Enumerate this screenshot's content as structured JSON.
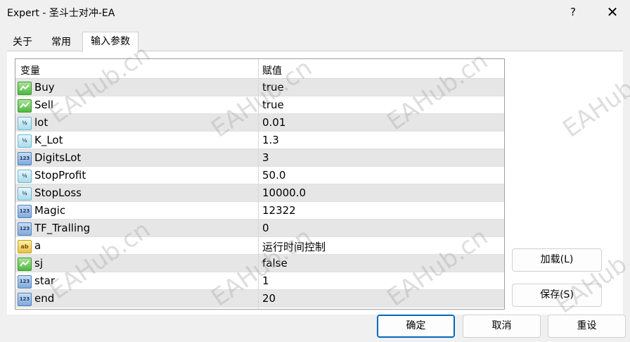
{
  "window": {
    "title": "Expert - 圣斗士对冲-EA",
    "help_label": "?",
    "close_label": "✕"
  },
  "tabs": [
    {
      "label": "关于"
    },
    {
      "label": "常用"
    },
    {
      "label": "输入参数",
      "active": true
    }
  ],
  "grid": {
    "headers": {
      "variable": "变量",
      "value": "赋值"
    },
    "rows": [
      {
        "name": "Buy",
        "value": "true",
        "type": "bool",
        "icon": "bool-icon"
      },
      {
        "name": "Sell",
        "value": "true",
        "type": "bool",
        "icon": "bool-icon"
      },
      {
        "name": "lot",
        "value": "0.01",
        "type": "double",
        "icon": "double-icon",
        "glyph": "½"
      },
      {
        "name": "K_Lot",
        "value": "1.3",
        "type": "double",
        "icon": "double-icon",
        "glyph": "½"
      },
      {
        "name": "DigitsLot",
        "value": "3",
        "type": "int",
        "icon": "int-icon",
        "glyph": "123"
      },
      {
        "name": "StopProfit",
        "value": "50.0",
        "type": "double",
        "icon": "double-icon",
        "glyph": "½"
      },
      {
        "name": "StopLoss",
        "value": "10000.0",
        "type": "double",
        "icon": "double-icon",
        "glyph": "½"
      },
      {
        "name": "Magic",
        "value": "12322",
        "type": "int",
        "icon": "int-icon",
        "glyph": "123"
      },
      {
        "name": "TF_Tralling",
        "value": "0",
        "type": "int",
        "icon": "int-icon",
        "glyph": "123"
      },
      {
        "name": "a",
        "value": "运行时间控制",
        "type": "string",
        "icon": "string-icon",
        "glyph": "ab"
      },
      {
        "name": "sj",
        "value": "false",
        "type": "bool",
        "icon": "bool-icon"
      },
      {
        "name": "star",
        "value": "1",
        "type": "int",
        "icon": "int-icon",
        "glyph": "123"
      },
      {
        "name": "end",
        "value": "20",
        "type": "int",
        "icon": "int-icon",
        "glyph": "123"
      }
    ]
  },
  "buttons": {
    "load": "加载(L)",
    "save": "保存(S)",
    "ok": "确定",
    "cancel": "取消",
    "reset": "重设"
  },
  "watermark": "EAHub.cn",
  "colors": {
    "accent": "#0067c0",
    "row_alt": "#e6e6e6"
  }
}
